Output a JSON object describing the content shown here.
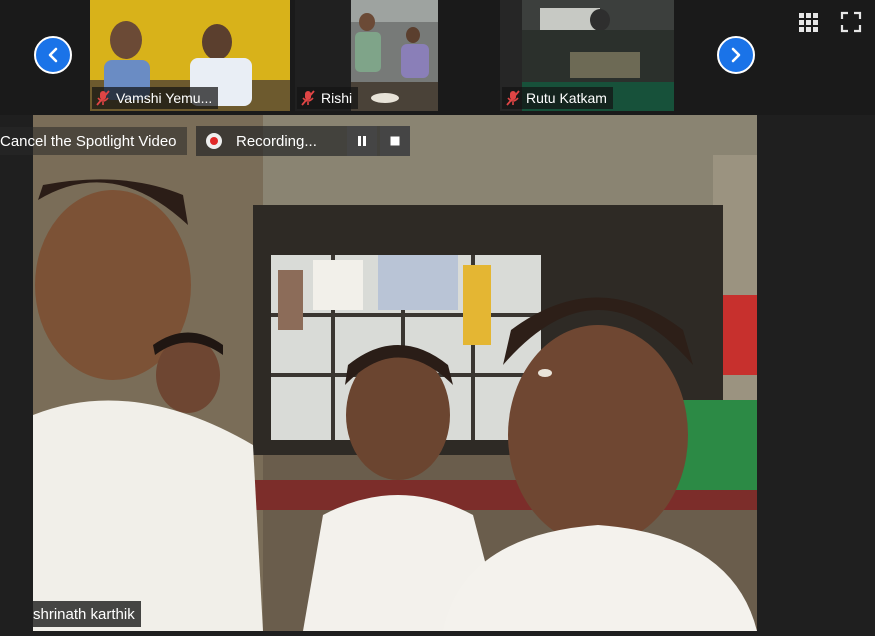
{
  "participants": [
    {
      "name": "Vamshi Yemu...",
      "muted": true
    },
    {
      "name": "Rishi",
      "muted": true
    },
    {
      "name": "Rutu Katkam",
      "muted": true
    }
  ],
  "spotlight": {
    "cancel_label": "Cancel the Spotlight Video",
    "speaker_name": "shrinath karthik"
  },
  "recording": {
    "status_label": "Recording..."
  },
  "icons": {
    "prev": "chevron-left-icon",
    "next": "chevron-right-icon",
    "grid": "grid-view-icon",
    "fullscreen": "fullscreen-icon",
    "muted": "mic-muted-icon"
  },
  "colors": {
    "nav_button": "#1a73e8",
    "muted_icon": "#e04545",
    "recording_dot": "#e02828"
  }
}
